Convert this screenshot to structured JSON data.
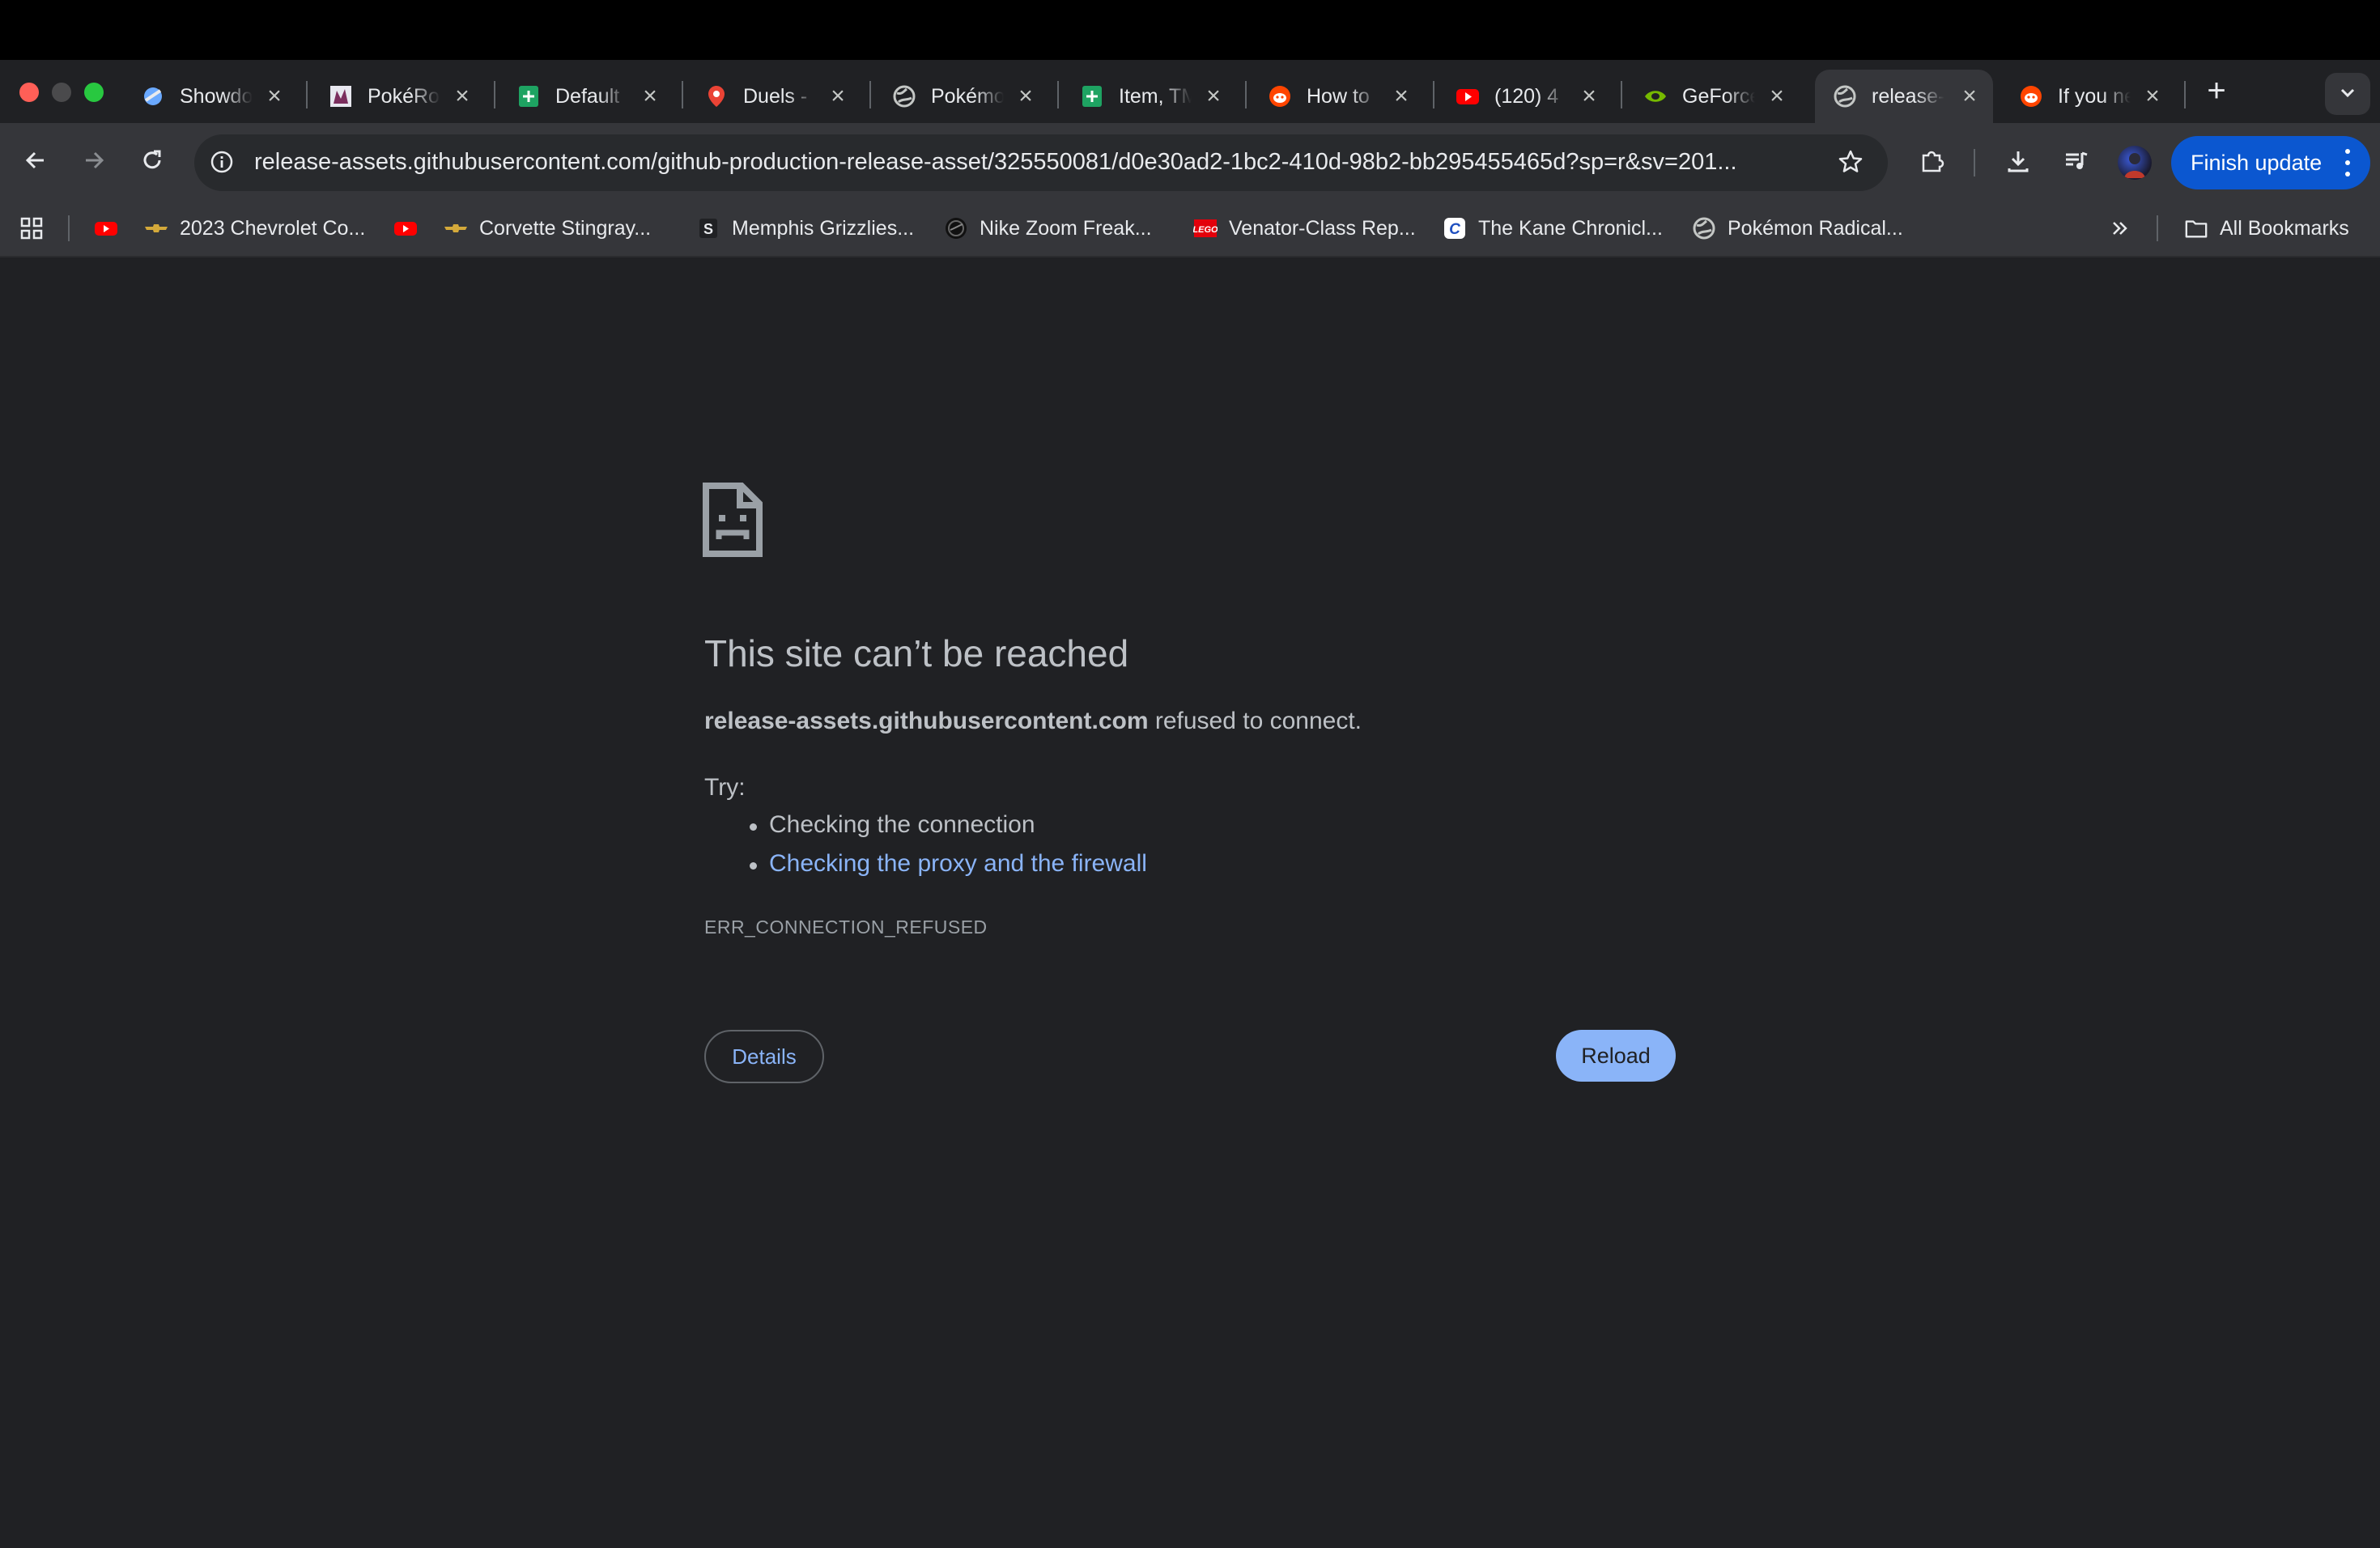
{
  "window": {
    "traffic_lights": [
      "close",
      "minimize",
      "zoom"
    ]
  },
  "tabs": [
    {
      "title": "Showdown",
      "icon": "showdown-favicon-icon",
      "active": false
    },
    {
      "title": "PokéRogue",
      "icon": "pokerogue-favicon-icon",
      "active": false
    },
    {
      "title": "Default",
      "icon": "sheets-favicon-icon",
      "active": false
    },
    {
      "title": "Duels - ",
      "icon": "maps-pin-favicon-icon",
      "active": false
    },
    {
      "title": "Pokémon",
      "icon": "globe-favicon-icon",
      "active": false
    },
    {
      "title": "Item, TM",
      "icon": "sheets-favicon-icon",
      "active": false
    },
    {
      "title": "How to",
      "icon": "reddit-favicon-icon",
      "active": false
    },
    {
      "title": "(120) 4",
      "icon": "youtube-favicon-icon",
      "active": false
    },
    {
      "title": "GeForce",
      "icon": "nvidia-favicon-icon",
      "active": false
    },
    {
      "title": "release-",
      "icon": "globe-favicon-icon",
      "active": true
    },
    {
      "title": "If you ne",
      "icon": "reddit-favicon-icon",
      "active": false
    }
  ],
  "toolbar": {
    "url": "release-assets.githubusercontent.com/github-production-release-asset/325550081/d0e30ad2-1bc2-410d-98b2-bb295455465d?sp=r&sv=201...",
    "finish_update_label": "Finish update"
  },
  "bookmarks": {
    "items": [
      {
        "label": "",
        "icon": "youtube-icon"
      },
      {
        "label": "2023 Chevrolet Co...",
        "icon": "chevrolet-icon"
      },
      {
        "label": "",
        "icon": "youtube-icon"
      },
      {
        "label": "Corvette Stingray...",
        "icon": "chevrolet-icon"
      },
      {
        "label": "Memphis Grizzlies...",
        "icon": "s-logo-icon"
      },
      {
        "label": "Nike Zoom Freak...",
        "icon": "nike-icon"
      },
      {
        "label": "Venator-Class Rep...",
        "icon": "lego-icon"
      },
      {
        "label": "The Kane Chronicl...",
        "icon": "c-logo-icon"
      },
      {
        "label": "Pokémon Radical...",
        "icon": "globe-icon"
      }
    ],
    "all_bookmarks_label": "All Bookmarks"
  },
  "error": {
    "title": "This site can’t be reached",
    "host": "release-assets.githubusercontent.com",
    "message_suffix": " refused to connect.",
    "try_label": "Try:",
    "suggestions": [
      "Checking the connection",
      "Checking the proxy and the firewall"
    ],
    "code": "ERR_CONNECTION_REFUSED",
    "details_label": "Details",
    "reload_label": "Reload"
  },
  "colors": {
    "background": "#202124",
    "toolbar": "#35363a",
    "link": "#8ab4f8",
    "finish_update": "#0b57d0"
  }
}
